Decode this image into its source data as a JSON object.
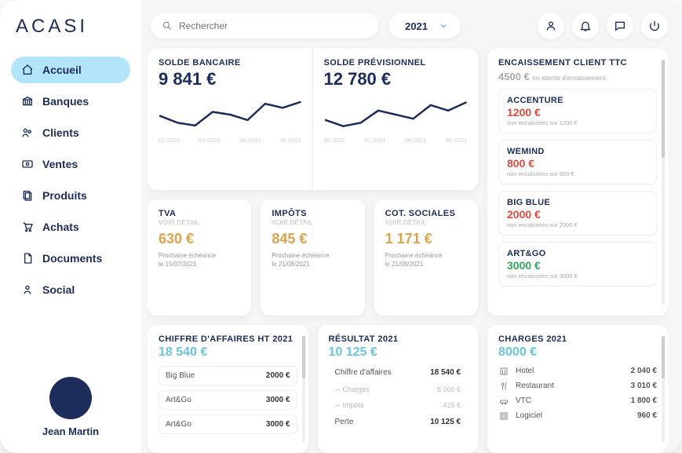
{
  "brand": "ACASI",
  "sidebar": {
    "items": [
      {
        "label": "Accueil",
        "icon": "home-icon",
        "active": true
      },
      {
        "label": "Banques",
        "icon": "bank-icon",
        "active": false
      },
      {
        "label": "Clients",
        "icon": "clients-icon",
        "active": false
      },
      {
        "label": "Ventes",
        "icon": "sales-icon",
        "active": false
      },
      {
        "label": "Produits",
        "icon": "products-icon",
        "active": false
      },
      {
        "label": "Achats",
        "icon": "cart-icon",
        "active": false
      },
      {
        "label": "Documents",
        "icon": "document-icon",
        "active": false
      },
      {
        "label": "Social",
        "icon": "social-icon",
        "active": false
      }
    ]
  },
  "user": {
    "name": "Jean Martin"
  },
  "topbar": {
    "search_placeholder": "Rechercher",
    "year": "2021",
    "icons": [
      "user-icon",
      "bell-icon",
      "chat-icon",
      "power-icon"
    ]
  },
  "balance": {
    "bank_title": "SOLDE BANCAIRE",
    "bank_amount": "9 841 €",
    "bank_xlabels": [
      "02 /2021",
      "03 /2021",
      "04 /2021",
      "05 /2021"
    ],
    "forecast_title": "SOLDE PRÉVISIONNEL",
    "forecast_amount": "12 780 €",
    "forecast_xlabels": [
      "06 /2021",
      "07 /2021",
      "08 /2021",
      "09 /2021"
    ]
  },
  "taxes": {
    "tva": {
      "title": "TVA",
      "detail": "VOIR DÉTAIL",
      "amount": "630 €",
      "note_line1": "Prochaine échéance",
      "note_line2": "le 15/07/2021"
    },
    "impots": {
      "title": "IMPÔTS",
      "detail": "VOIR DÉTAIL",
      "amount": "845 €",
      "note_line1": "Prochaine échéance",
      "note_line2": "le 21/08/2021"
    },
    "cot": {
      "title": "COT. SOCIALES",
      "detail": "VOIR DÉTAIL",
      "amount": "1 171 €",
      "note_line1": "Prochaine échéance",
      "note_line2": "le 21/08/2021"
    }
  },
  "encaissement": {
    "title": "ENCAISSEMENT CLIENT TTC",
    "total_amount": "4500 €",
    "total_suffix": "en attente d'encaissement",
    "clients": [
      {
        "name": "ACCENTURE",
        "amount": "1200 €",
        "color": "red",
        "sub": "non encaissées sur 1200 €"
      },
      {
        "name": "WEMIND",
        "amount": "800 €",
        "color": "red",
        "sub": "non encaissées sur 800 €"
      },
      {
        "name": "BIG BLUE",
        "amount": "2000 €",
        "color": "red",
        "sub": "non encaissées sur 2000 €"
      },
      {
        "name": "ART&GO",
        "amount": "3000 €",
        "color": "green",
        "sub": "non encaissées sur 3000 €"
      }
    ]
  },
  "ca": {
    "title": "CHIFFRE D'AFFAIRES HT 2021",
    "amount": "18 540 €",
    "rows": [
      {
        "label": "Big Blue",
        "value": "2000 €"
      },
      {
        "label": "Art&Go",
        "value": "3000 €"
      },
      {
        "label": "Art&Go",
        "value": "3000 €"
      }
    ]
  },
  "resultat": {
    "title": "RÉSULTAT 2021",
    "amount": "10 125 €",
    "rows": [
      {
        "label": "Chiffre d'affaires",
        "value": "18 540 €",
        "kind": "plain"
      },
      {
        "label": "Charges",
        "value": "8 000 €",
        "kind": "sub"
      },
      {
        "label": "Impôts",
        "value": "415 €",
        "kind": "sub"
      },
      {
        "label": "Perte",
        "value": "10 125 €",
        "kind": "plain"
      }
    ]
  },
  "charges": {
    "title": "CHARGES 2021",
    "amount": "8000 €",
    "rows": [
      {
        "icon": "hotel-icon",
        "label": "Hotel",
        "value": "2 040 €"
      },
      {
        "icon": "restaurant-icon",
        "label": "Restaurant",
        "value": "3 010 €"
      },
      {
        "icon": "vtc-icon",
        "label": "VTC",
        "value": "1 800 €"
      },
      {
        "icon": "software-icon",
        "label": "Logiciel",
        "value": "960 €"
      }
    ]
  },
  "chart_data": [
    {
      "type": "line",
      "title": "SOLDE BANCAIRE",
      "categories": [
        "02/2021",
        "03/2021",
        "04/2021",
        "05/2021"
      ],
      "x": [
        0,
        1,
        2,
        3,
        4,
        5,
        6,
        7,
        8
      ],
      "values": [
        7800,
        6800,
        6400,
        8400,
        8000,
        7200,
        9600,
        9000,
        9841
      ],
      "ylim": [
        5000,
        11000
      ],
      "xlabel": "",
      "ylabel": "€"
    },
    {
      "type": "line",
      "title": "SOLDE PRÉVISIONNEL",
      "categories": [
        "06/2021",
        "07/2021",
        "08/2021",
        "09/2021"
      ],
      "x": [
        0,
        1,
        2,
        3,
        4,
        5,
        6,
        7,
        8
      ],
      "values": [
        10200,
        9300,
        9800,
        11600,
        11000,
        10400,
        12400,
        11600,
        12780
      ],
      "ylim": [
        8000,
        14000
      ],
      "xlabel": "",
      "ylabel": "€"
    }
  ]
}
